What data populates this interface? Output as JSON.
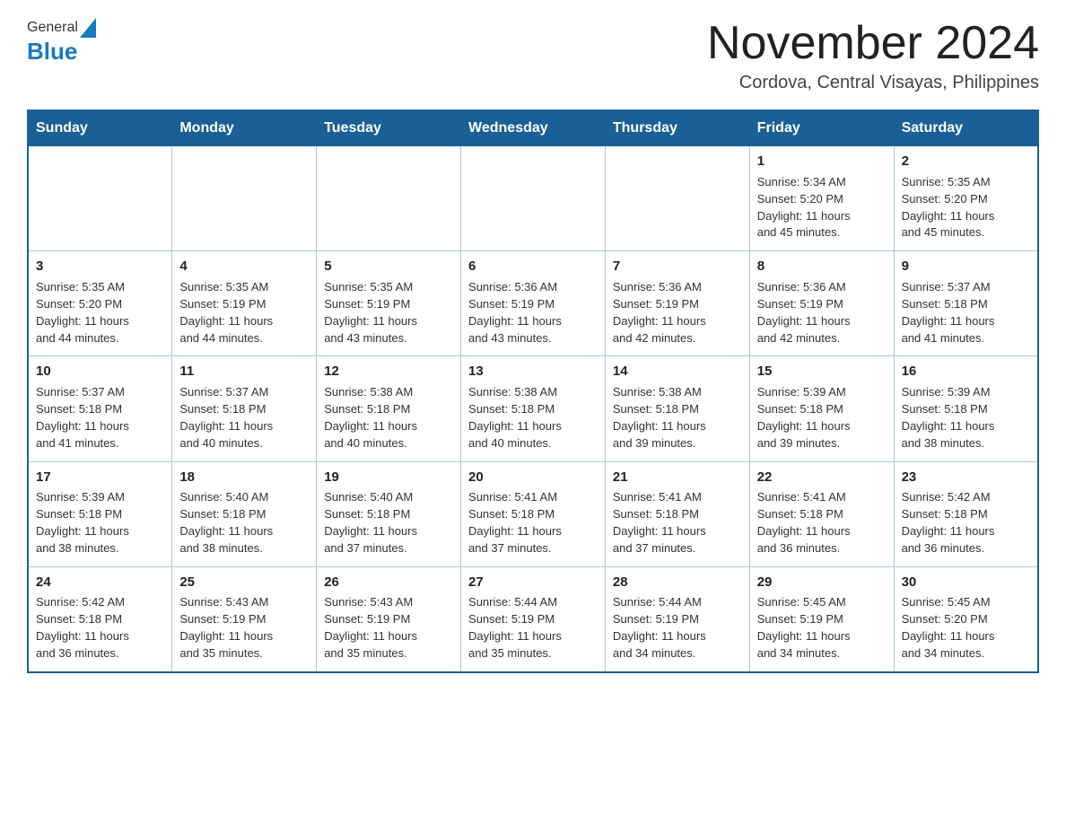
{
  "logo": {
    "general": "General",
    "blue": "Blue"
  },
  "title": "November 2024",
  "subtitle": "Cordova, Central Visayas, Philippines",
  "days": [
    "Sunday",
    "Monday",
    "Tuesday",
    "Wednesday",
    "Thursday",
    "Friday",
    "Saturday"
  ],
  "weeks": [
    [
      {
        "day": "",
        "info": ""
      },
      {
        "day": "",
        "info": ""
      },
      {
        "day": "",
        "info": ""
      },
      {
        "day": "",
        "info": ""
      },
      {
        "day": "",
        "info": ""
      },
      {
        "day": "1",
        "info": "Sunrise: 5:34 AM\nSunset: 5:20 PM\nDaylight: 11 hours\nand 45 minutes."
      },
      {
        "day": "2",
        "info": "Sunrise: 5:35 AM\nSunset: 5:20 PM\nDaylight: 11 hours\nand 45 minutes."
      }
    ],
    [
      {
        "day": "3",
        "info": "Sunrise: 5:35 AM\nSunset: 5:20 PM\nDaylight: 11 hours\nand 44 minutes."
      },
      {
        "day": "4",
        "info": "Sunrise: 5:35 AM\nSunset: 5:19 PM\nDaylight: 11 hours\nand 44 minutes."
      },
      {
        "day": "5",
        "info": "Sunrise: 5:35 AM\nSunset: 5:19 PM\nDaylight: 11 hours\nand 43 minutes."
      },
      {
        "day": "6",
        "info": "Sunrise: 5:36 AM\nSunset: 5:19 PM\nDaylight: 11 hours\nand 43 minutes."
      },
      {
        "day": "7",
        "info": "Sunrise: 5:36 AM\nSunset: 5:19 PM\nDaylight: 11 hours\nand 42 minutes."
      },
      {
        "day": "8",
        "info": "Sunrise: 5:36 AM\nSunset: 5:19 PM\nDaylight: 11 hours\nand 42 minutes."
      },
      {
        "day": "9",
        "info": "Sunrise: 5:37 AM\nSunset: 5:18 PM\nDaylight: 11 hours\nand 41 minutes."
      }
    ],
    [
      {
        "day": "10",
        "info": "Sunrise: 5:37 AM\nSunset: 5:18 PM\nDaylight: 11 hours\nand 41 minutes."
      },
      {
        "day": "11",
        "info": "Sunrise: 5:37 AM\nSunset: 5:18 PM\nDaylight: 11 hours\nand 40 minutes."
      },
      {
        "day": "12",
        "info": "Sunrise: 5:38 AM\nSunset: 5:18 PM\nDaylight: 11 hours\nand 40 minutes."
      },
      {
        "day": "13",
        "info": "Sunrise: 5:38 AM\nSunset: 5:18 PM\nDaylight: 11 hours\nand 40 minutes."
      },
      {
        "day": "14",
        "info": "Sunrise: 5:38 AM\nSunset: 5:18 PM\nDaylight: 11 hours\nand 39 minutes."
      },
      {
        "day": "15",
        "info": "Sunrise: 5:39 AM\nSunset: 5:18 PM\nDaylight: 11 hours\nand 39 minutes."
      },
      {
        "day": "16",
        "info": "Sunrise: 5:39 AM\nSunset: 5:18 PM\nDaylight: 11 hours\nand 38 minutes."
      }
    ],
    [
      {
        "day": "17",
        "info": "Sunrise: 5:39 AM\nSunset: 5:18 PM\nDaylight: 11 hours\nand 38 minutes."
      },
      {
        "day": "18",
        "info": "Sunrise: 5:40 AM\nSunset: 5:18 PM\nDaylight: 11 hours\nand 38 minutes."
      },
      {
        "day": "19",
        "info": "Sunrise: 5:40 AM\nSunset: 5:18 PM\nDaylight: 11 hours\nand 37 minutes."
      },
      {
        "day": "20",
        "info": "Sunrise: 5:41 AM\nSunset: 5:18 PM\nDaylight: 11 hours\nand 37 minutes."
      },
      {
        "day": "21",
        "info": "Sunrise: 5:41 AM\nSunset: 5:18 PM\nDaylight: 11 hours\nand 37 minutes."
      },
      {
        "day": "22",
        "info": "Sunrise: 5:41 AM\nSunset: 5:18 PM\nDaylight: 11 hours\nand 36 minutes."
      },
      {
        "day": "23",
        "info": "Sunrise: 5:42 AM\nSunset: 5:18 PM\nDaylight: 11 hours\nand 36 minutes."
      }
    ],
    [
      {
        "day": "24",
        "info": "Sunrise: 5:42 AM\nSunset: 5:18 PM\nDaylight: 11 hours\nand 36 minutes."
      },
      {
        "day": "25",
        "info": "Sunrise: 5:43 AM\nSunset: 5:19 PM\nDaylight: 11 hours\nand 35 minutes."
      },
      {
        "day": "26",
        "info": "Sunrise: 5:43 AM\nSunset: 5:19 PM\nDaylight: 11 hours\nand 35 minutes."
      },
      {
        "day": "27",
        "info": "Sunrise: 5:44 AM\nSunset: 5:19 PM\nDaylight: 11 hours\nand 35 minutes."
      },
      {
        "day": "28",
        "info": "Sunrise: 5:44 AM\nSunset: 5:19 PM\nDaylight: 11 hours\nand 34 minutes."
      },
      {
        "day": "29",
        "info": "Sunrise: 5:45 AM\nSunset: 5:19 PM\nDaylight: 11 hours\nand 34 minutes."
      },
      {
        "day": "30",
        "info": "Sunrise: 5:45 AM\nSunset: 5:20 PM\nDaylight: 11 hours\nand 34 minutes."
      }
    ]
  ]
}
